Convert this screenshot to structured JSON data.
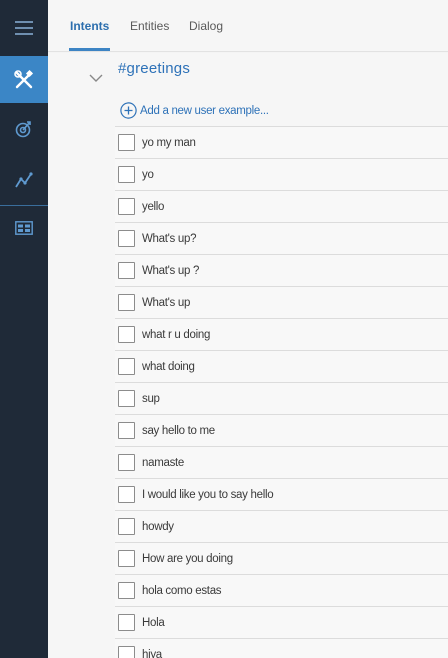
{
  "nav": {
    "icons": [
      "hamburger-menu-icon",
      "tools-icon",
      "target-icon",
      "analytics-icon",
      "dashboard-icon"
    ]
  },
  "tabs": [
    {
      "label": "Intents",
      "active": true
    },
    {
      "label": "Entities",
      "active": false
    },
    {
      "label": "Dialog",
      "active": false
    }
  ],
  "intent": {
    "name": "#greetings",
    "add_example_label": "Add a new user example...",
    "examples": [
      "yo my man",
      "yo",
      "yello",
      "What's up?",
      "What's up ?",
      "What's up",
      "what r u doing",
      "what doing",
      "sup",
      "say hello to me",
      "namaste",
      "I would like you to say hello",
      "howdy",
      "How are you doing",
      "hola como estas",
      "Hola",
      "hiya"
    ]
  },
  "colors": {
    "rail": "#1f2a38",
    "rail_active": "#3b86c6",
    "accent": "#2e72b8"
  }
}
